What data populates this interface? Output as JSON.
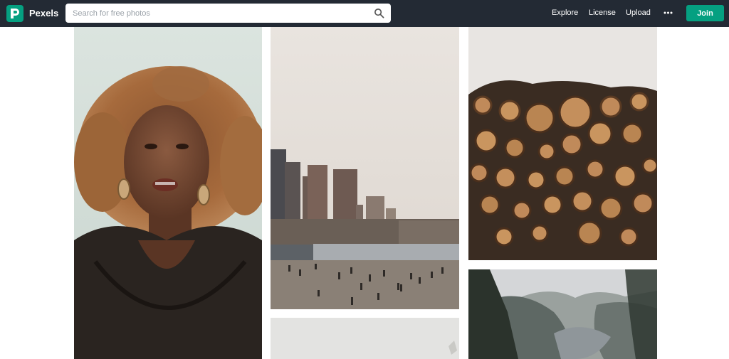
{
  "header": {
    "brand": "Pexels",
    "logo_letter": "P",
    "search": {
      "placeholder": "Search for free photos"
    },
    "nav": {
      "explore": "Explore",
      "license": "License",
      "upload": "Upload"
    },
    "more_icon": "more-dots-icon",
    "join_label": "Join"
  },
  "colors": {
    "header_bg": "#232a34",
    "accent": "#05a081",
    "page_bg": "#ffffff"
  },
  "photos": [
    {
      "name": "photo-woman-curly-hair"
    },
    {
      "name": "photo-city-harbor"
    },
    {
      "name": "photo-stacked-logs"
    },
    {
      "name": "photo-fjord-mountains"
    },
    {
      "name": "photo-bottom-middle"
    }
  ]
}
